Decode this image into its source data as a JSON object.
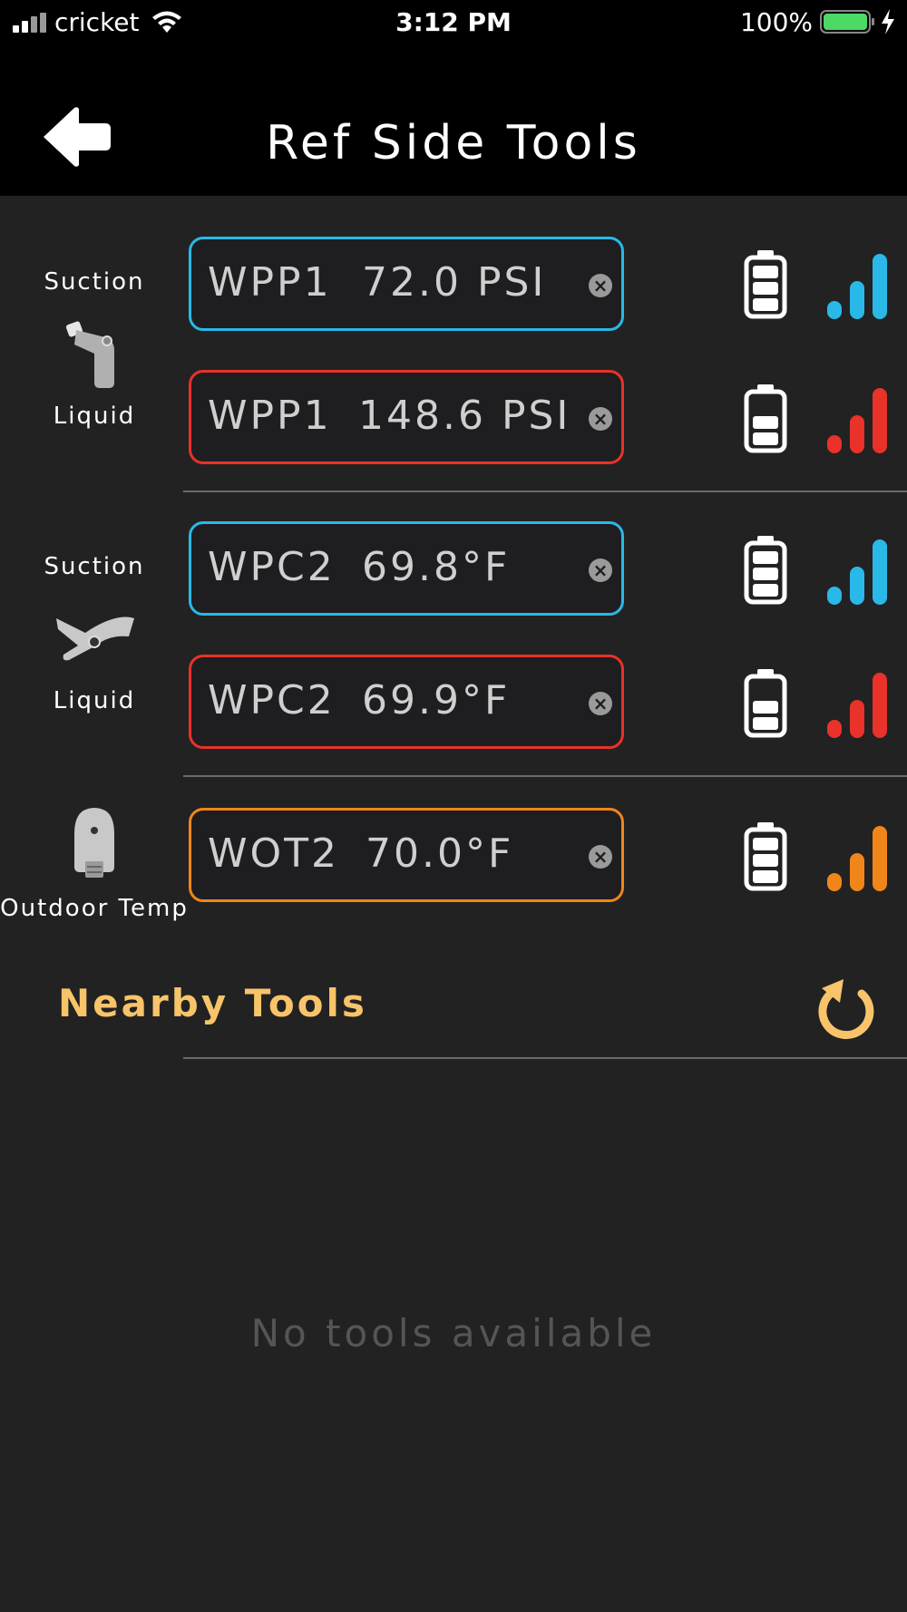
{
  "status_bar": {
    "carrier": "cricket",
    "time": "3:12 PM",
    "battery_percent": "100%"
  },
  "header": {
    "title": "Ref Side Tools",
    "back_icon": "back-arrow-icon"
  },
  "groups": [
    {
      "icon": "pressure-probe-icon",
      "top_label": "Suction",
      "bottom_label": "Liquid",
      "tools": [
        {
          "name": "WPP1",
          "reading": "72.0 PSI",
          "color": "#2ab8e8",
          "battery_bars": 3,
          "signal_bars": 3
        },
        {
          "name": "WPP1",
          "reading": "148.6 PSI",
          "color": "#e8322a",
          "battery_bars": 2,
          "signal_bars": 3
        }
      ]
    },
    {
      "icon": "pipe-clamp-icon",
      "top_label": "Suction",
      "bottom_label": "Liquid",
      "tools": [
        {
          "name": "WPC2",
          "reading": "69.8°F",
          "color": "#2ab8e8",
          "battery_bars": 3,
          "signal_bars": 3
        },
        {
          "name": "WPC2",
          "reading": "69.9°F",
          "color": "#e8322a",
          "battery_bars": 2,
          "signal_bars": 3
        }
      ]
    },
    {
      "icon": "outdoor-temp-sensor-icon",
      "bottom_label": "Outdoor Temp",
      "tools": [
        {
          "name": "WOT2",
          "reading": "70.0°F",
          "color": "#f0861a",
          "battery_bars": 3,
          "signal_bars": 3
        }
      ]
    }
  ],
  "nearby": {
    "title": "Nearby Tools",
    "refresh_icon": "refresh-icon",
    "empty_message": "No tools available",
    "accent": "#f8c46a"
  }
}
